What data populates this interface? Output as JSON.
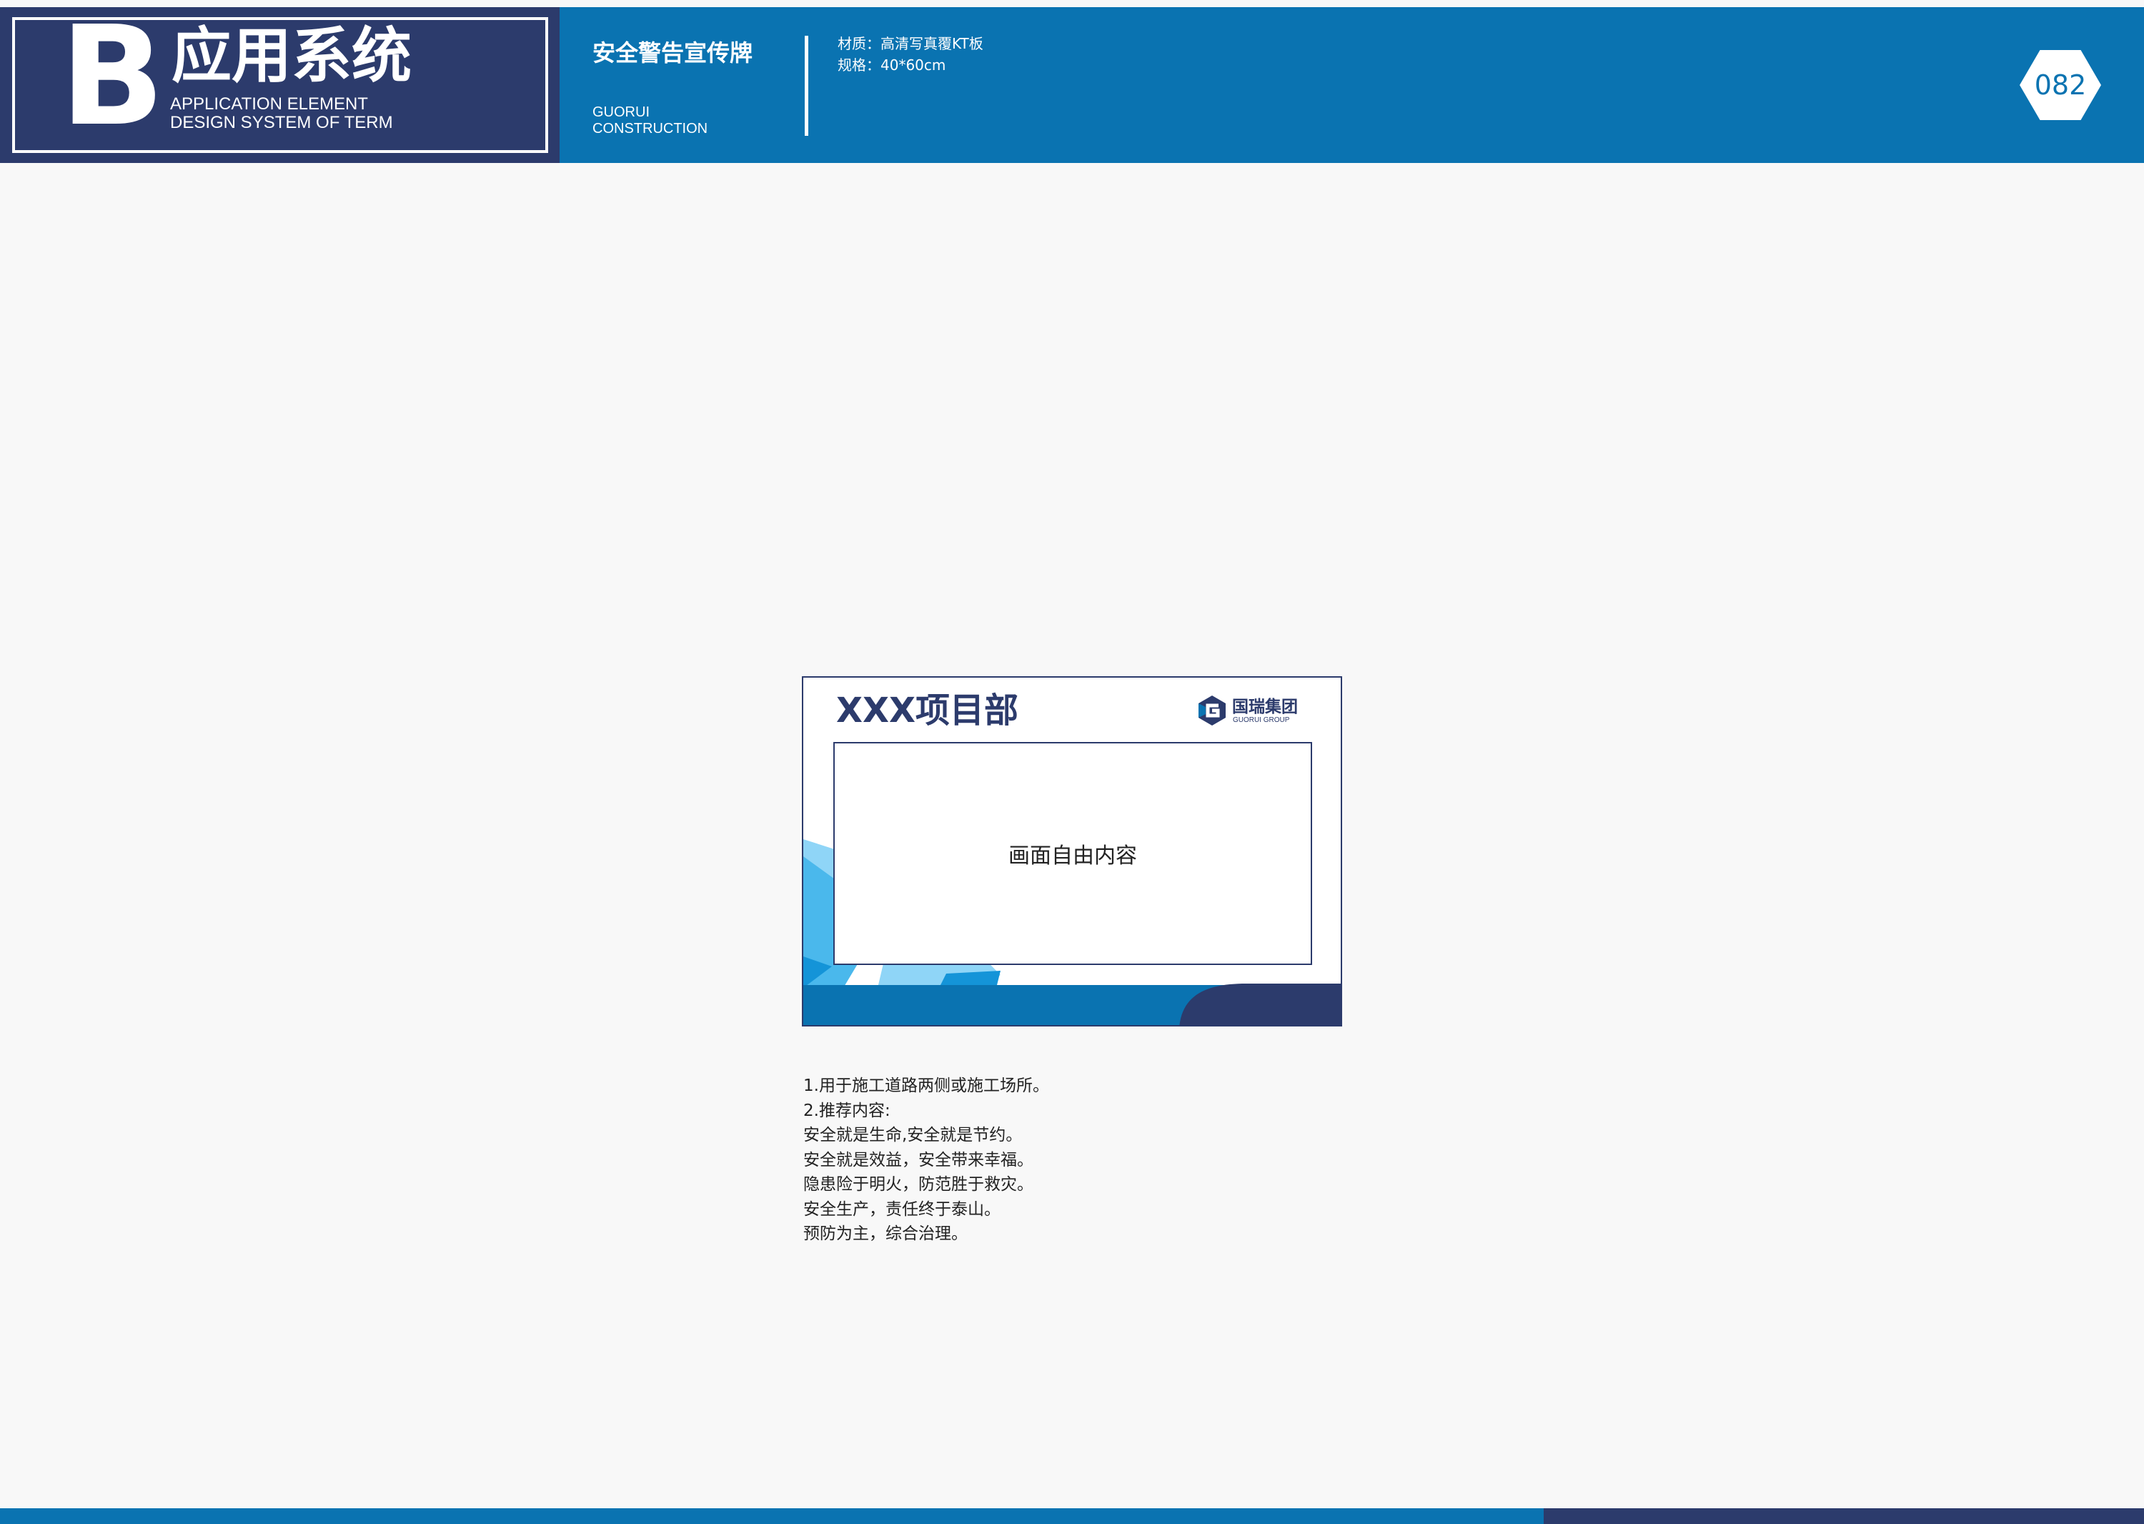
{
  "header": {
    "brand_letter": "B",
    "brand_title": "应用系统",
    "brand_subtitle_line1": "APPLICATION ELEMENT",
    "brand_subtitle_line2": "DESIGN SYSTEM OF TERM",
    "sign_title": "安全警告宣传牌",
    "company_line1": "GUORUI",
    "company_line2": "CONSTRUCTION",
    "material": "材质：高清写真覆KT板",
    "size": "规格：40*60cm",
    "page_number": "082"
  },
  "sign": {
    "project_name": "XXX项目部",
    "logo_cn": "国瑞集团",
    "logo_en": "GUORUI GROUP",
    "content_placeholder": "画面自由内容"
  },
  "notes": [
    "1.用于施工道路两侧或施工场所。",
    "2.推荐内容:",
    "安全就是生命,安全就是节约。",
    "安全就是效益，安全带来幸福。",
    "隐患险于明火，防范胜于救灾。",
    "安全生产，责任终于泰山。",
    "预防为主，综合治理。"
  ],
  "colors": {
    "primary_blue": "#0a73b1",
    "navy": "#2c3b6c",
    "light_blue": "#4ab8ec",
    "page_background": "#f8f8f8"
  }
}
